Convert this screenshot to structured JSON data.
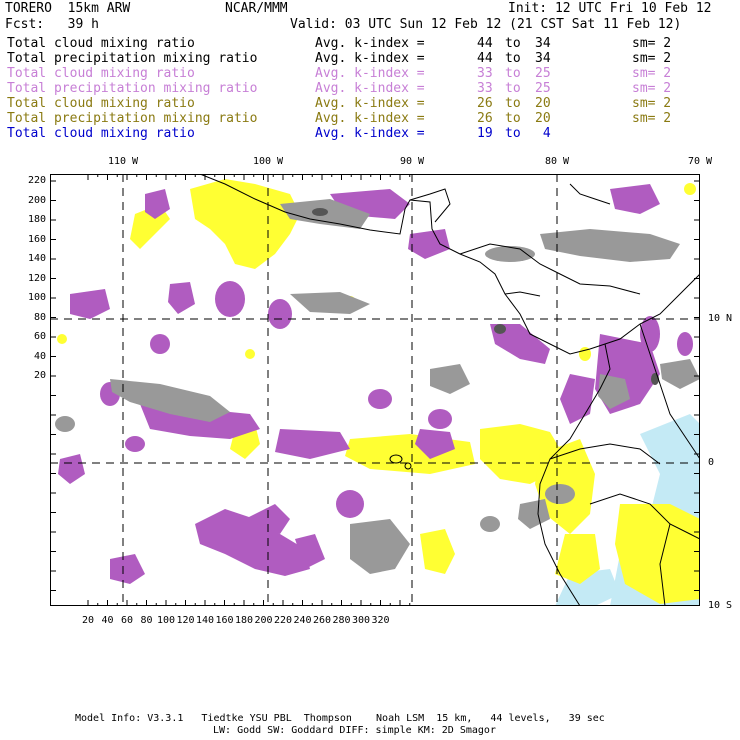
{
  "header": {
    "model": "TORERO  15km ARW",
    "org": "NCAR/MMM",
    "init": "Init: 12 UTC Fri 10 Feb 12",
    "fcst": "Fcst:   39 h",
    "valid": "Valid: 03 UTC Sun 12 Feb 12 (21 CST Sat 11 Feb 12)"
  },
  "legend": [
    {
      "field": "Total cloud mixing ratio",
      "stat": "Avg. k-index =",
      "from": "44",
      "to_word": "to",
      "to": "34",
      "sm": "sm= 2",
      "color": "#000000"
    },
    {
      "field": "Total precipitation mixing ratio",
      "stat": "Avg. k-index =",
      "from": "44",
      "to_word": "to",
      "to": "34",
      "sm": "sm= 2",
      "color": "#000000"
    },
    {
      "field": "Total cloud mixing ratio",
      "stat": "Avg. k-index =",
      "from": "33",
      "to_word": "to",
      "to": "25",
      "sm": "sm= 2",
      "color": "#c77fd6"
    },
    {
      "field": "Total precipitation mixing ratio",
      "stat": "Avg. k-index =",
      "from": "33",
      "to_word": "to",
      "to": "25",
      "sm": "sm= 2",
      "color": "#c77fd6"
    },
    {
      "field": "Total cloud mixing ratio",
      "stat": "Avg. k-index =",
      "from": "26",
      "to_word": "to",
      "to": "20",
      "sm": "sm= 2",
      "color": "#8a7a12"
    },
    {
      "field": "Total precipitation mixing ratio",
      "stat": "Avg. k-index =",
      "from": "26",
      "to_word": "to",
      "to": "20",
      "sm": "sm= 2",
      "color": "#8a7a12"
    },
    {
      "field": "Total cloud mixing ratio",
      "stat": "Avg. k-index =",
      "from": "19",
      "to_word": "to",
      "to": " 4",
      "sm": "",
      "color": "#0000cc"
    }
  ],
  "map": {
    "top_lon_labels": [
      "110 W",
      "100 W",
      "90 W",
      "80 W",
      "70 W"
    ],
    "right_lat_labels": [
      "10 N",
      "0",
      "10 S"
    ],
    "y_ticks": [
      "220",
      "200",
      "180",
      "160",
      "140",
      "120",
      "100",
      "80",
      "60",
      "40",
      "20"
    ],
    "x_ticks": [
      "20",
      "40",
      "60",
      "80",
      "100",
      "120",
      "140",
      "160",
      "180",
      "200",
      "220",
      "240",
      "260",
      "280",
      "300",
      "320"
    ],
    "colors": {
      "yellow": "#ffff33",
      "purple": "#b05cc0",
      "gray": "#999999",
      "lightblue": "#c4eaf5"
    }
  },
  "footer": {
    "line1": "Model Info: V3.3.1   Tiedtke YSU PBL  Thompson    Noah LSM  15 km,   44 levels,   39 sec",
    "line2": "LW: Godd SW: Goddard DIFF: simple KM: 2D Smagor"
  }
}
